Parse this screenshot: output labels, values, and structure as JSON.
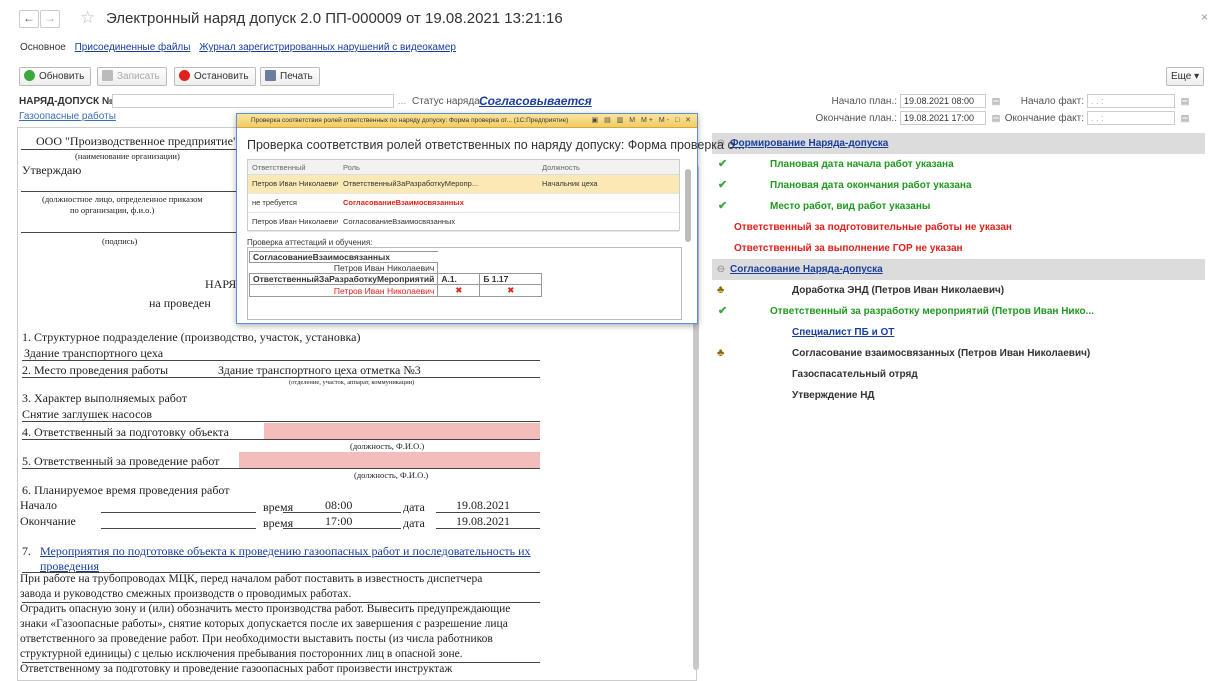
{
  "window": {
    "title": "Электронный наряд допуск 2.0 ПП-000009 от 19.08.2021 13:21:16",
    "close": "×",
    "back": "←",
    "forward": "→",
    "star": "☆"
  },
  "tabs": [
    {
      "label": "Основное",
      "active": true
    },
    {
      "label": "Присоединенные файлы",
      "active": false
    },
    {
      "label": "Журнал зарегистрированных нарушений с видеокамер",
      "active": false
    }
  ],
  "toolbar": {
    "refresh": "Обновить",
    "save": "Записать",
    "stop": "Остановить",
    "print": "Печать",
    "more": "Еще ▾"
  },
  "form": {
    "permit_label": "НАРЯД-ДОПУСК №",
    "permit_value": "",
    "status_label": "Статус наряда:",
    "status_value": "Согласовывается",
    "gas_link": "Газоопасные работы",
    "plan_start_label": "Начало план.:",
    "plan_start_value": "19.08.2021 08:00",
    "plan_end_label": "Окончание план.:",
    "plan_end_value": "19.08.2021 17:00",
    "fact_start_label": "Начало факт:",
    "fact_start_value": " .  .     :",
    "fact_end_label": "Окончание факт:",
    "fact_end_value": " .  .     :"
  },
  "document": {
    "org": "ООО \"Производственное предприятие\"",
    "org_caption": "(наименование организации)",
    "approve": "Утверждаю",
    "person_caption_1": "(должностное лицо, определенное приказом",
    "person_caption_2": "по организации, ф.и.о.)",
    "sign_caption": "(подпись)",
    "heading_1": "НАРЯ",
    "heading_2": "на проведен",
    "item1": "1.    Структурное подразделение (производство, участок, установка)",
    "item1_value": "Здание транспортного цеха",
    "item2": "2.    Место проведения работы",
    "item2_value": "Здание транспортного цеха отметка №3",
    "item2_caption": "(отделение, участок, аппарат, коммуникации)",
    "item3": "3.    Характер выполняемых работ",
    "item3_value": "Снятие заглушек насосов",
    "item4": "4.    Ответственный за подготовку объекта",
    "item4_caption": "(должность, Ф.И.О.)",
    "item5": "5.    Ответственный за проведение работ",
    "item5_caption": "(должность, Ф.И.О.)",
    "item6": "6.    Планируемое время проведения работ",
    "start_label": "Начало",
    "end_label": "Окончание",
    "time_label": "время",
    "date_label": "дата",
    "start_time": "08:00",
    "start_date": "19.08.2021",
    "end_time": "17:00",
    "end_date": "19.08.2021",
    "item7_num": "7.",
    "item7_link_1": "Мероприятия по подготовке объекта к проведению газоопасных работ и последовательность их",
    "item7_link_2": "проведения",
    "p1_1": " При работе на трубопроводах МЦК, перед началом работ поставить в известность диспетчера",
    "p1_2": "завода и руководство смежных производств о проводимых работах.",
    "p2_1": " Оградить опасную зону и (или) обозначить место производства работ. Вывесить предупреждающие",
    "p2_2": "знаки «Газоопасные работы», снятие которых допускается после их завершения с разрешение лица",
    "p2_3": "ответственного за проведение работ. При необходимости выставить посты (из числа работников",
    "p2_4": "структурной единицы) с целью исключения пребывания посторонних лиц в опасной зоне.",
    "p3_1": " Ответственному за подготовку и проведение газоопасных работ произвести инструктаж"
  },
  "popup": {
    "titlebar": "Проверка соответствия ролей ответственных по наряду допуску: Форма проверка от...  (1С:Предприятие)",
    "titlebar_icons": "▣ ▤ ▥ M M+ M- □ ✕",
    "title": "Проверка соответствия ролей ответственных по наряду допуску: Форма проверка о...",
    "columns": [
      "Ответственный",
      "Роль",
      "Должность"
    ],
    "rows": [
      {
        "person": "Петров Иван Николаевич (00000000...",
        "role": "ОтветственныйЗаРазработкуМеропр...",
        "position": "Начальник цеха",
        "selected": true,
        "red": false
      },
      {
        "person": "не требуется",
        "role": "СогласованиеВзаимосвязанных",
        "position": "",
        "selected": false,
        "red": true
      },
      {
        "person": "Петров Иван Николаевич",
        "role": "СогласованиеВзаимосвязанных",
        "position": "",
        "selected": false,
        "red": false
      }
    ],
    "section": "Проверка аттестаций и обучения:",
    "cert": {
      "role1": "СогласованиеВзаимосвязанных",
      "role1_person": "Петров Иван Николаевич",
      "role2": "ОтветственныйЗаРазработкуМероприятий",
      "col_a": "А.1.",
      "col_b": "Б 1.17",
      "role2_person": "Петров Иван Николаевич",
      "mark": "✖"
    }
  },
  "right_panel": {
    "sections": [
      {
        "title": "Формирование Наряда-допуска",
        "minus": "⊖"
      },
      {
        "title": "Согласование Наряда-допуска",
        "minus": "⊖"
      }
    ],
    "items_1": [
      {
        "icon": "check",
        "text": "Плановая дата начала работ указана",
        "style": "ok"
      },
      {
        "icon": "check",
        "text": "Плановая дата окончания работ указана",
        "style": "ok"
      },
      {
        "icon": "check",
        "text": "Место работ, вид работ указаны",
        "style": "ok"
      },
      {
        "icon": "none",
        "text": "Ответственный за подготовительные работы не указан",
        "style": "red"
      },
      {
        "icon": "none",
        "text": "Ответственный за выполнение ГОР не указан",
        "style": "red"
      }
    ],
    "items_2": [
      {
        "icon": "user",
        "text": "Доработка ЭНД (Петров Иван Николаевич)",
        "style": "dark"
      },
      {
        "icon": "check",
        "text": "Ответственный за разработку мероприятий (Петров Иван Нико...",
        "style": "ok"
      },
      {
        "icon": "none",
        "text": "Специалист ПБ и ОТ",
        "style": "blue"
      },
      {
        "icon": "user",
        "text": "Согласование взаимосвязанных (Петров Иван Николаевич)",
        "style": "dark"
      },
      {
        "icon": "none",
        "text": "Газоспасательный отряд",
        "style": "dark"
      },
      {
        "icon": "none",
        "text": "Утверждение НД",
        "style": "dark"
      }
    ],
    "check_glyph": "✔",
    "user_glyph": "♣"
  },
  "colors": {
    "link": "#1a3e9c",
    "ok": "#1f9a1f",
    "error": "#e0201a",
    "highlight": "#f5bcbc",
    "popup_title": "#f2cc62"
  }
}
